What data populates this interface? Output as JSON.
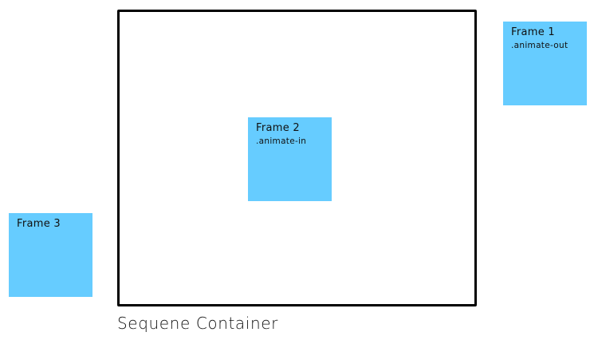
{
  "container": {
    "caption": "Sequene Container"
  },
  "frames": [
    {
      "title": "Frame 1",
      "class_name": ".animate-out"
    },
    {
      "title": "Frame 2",
      "class_name": ".animate-in"
    },
    {
      "title": "Frame 3",
      "class_name": ""
    }
  ],
  "colors": {
    "frame_fill": "#66ccff",
    "container_border": "#000000",
    "text": "#111111",
    "background": "#ffffff"
  }
}
